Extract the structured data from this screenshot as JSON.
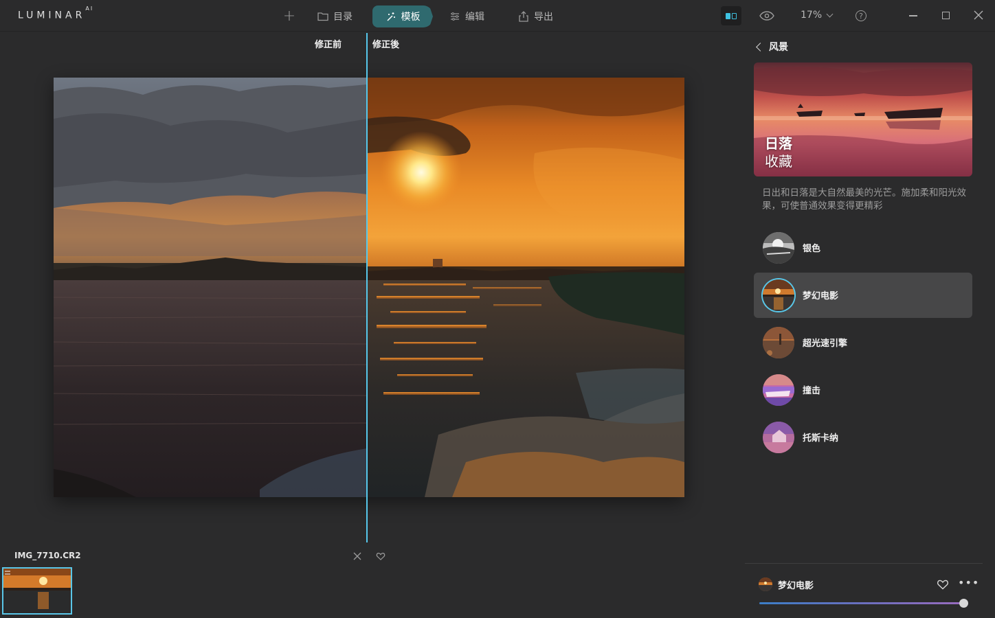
{
  "app": {
    "logo": "LUMINAR",
    "logo_sup": "AI"
  },
  "topbar": {
    "add_label": "+",
    "nav": [
      {
        "label": "目录",
        "icon": "folder-icon",
        "active": false
      },
      {
        "label": "模板",
        "icon": "magic-wand-icon",
        "active": true
      },
      {
        "label": "编辑",
        "icon": "sliders-icon",
        "active": false
      },
      {
        "label": "导出",
        "icon": "share-icon",
        "active": false
      }
    ],
    "zoom": "17%",
    "help": "?",
    "accent_color": "#2f6a6f",
    "compare_color": "#3ec1e0"
  },
  "canvas": {
    "before_label": "修正前",
    "after_label": "修正後",
    "split_color": "#56c8ec"
  },
  "filmstrip": {
    "filename": "IMG_7710.CR2"
  },
  "panel": {
    "back_title": "风景",
    "hero": {
      "title_line1": "日落",
      "title_line2": "收藏"
    },
    "description": "日出和日落是大自然最美的光芒。施加柔和阳光效果，可使普通效果变得更精彩",
    "templates": [
      {
        "name": "银色",
        "selected": false
      },
      {
        "name": "梦幻电影",
        "selected": true
      },
      {
        "name": "超光速引擎",
        "selected": false
      },
      {
        "name": "撞击",
        "selected": false
      },
      {
        "name": "托斯卡纳",
        "selected": false
      }
    ],
    "applied": {
      "name": "梦幻电影",
      "more": "•••",
      "amount": 1.0
    }
  }
}
